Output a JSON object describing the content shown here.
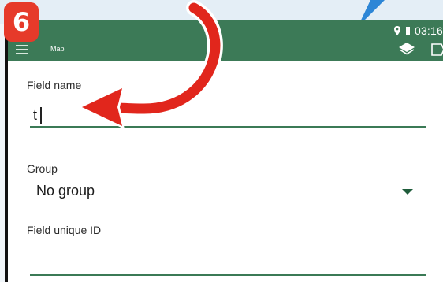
{
  "status_bar": {
    "time": "03:16"
  },
  "app_bar": {
    "title": "Map"
  },
  "form": {
    "field_name": {
      "label": "Field name",
      "value": "t"
    },
    "group": {
      "label": "Group",
      "value": "No group"
    },
    "field_unique_id": {
      "label": "Field unique ID",
      "value": ""
    }
  },
  "annotation": {
    "step_number": "6"
  },
  "colors": {
    "app_bar": "#3c7a57",
    "accent_line": "#3b7a56",
    "step_badge": "#e63a2a",
    "arrow": "#e1261c"
  },
  "icons": [
    "menu-icon",
    "layers-icon",
    "chat-icon",
    "location-pin-icon",
    "battery-icon",
    "dropdown-arrow-icon"
  ]
}
